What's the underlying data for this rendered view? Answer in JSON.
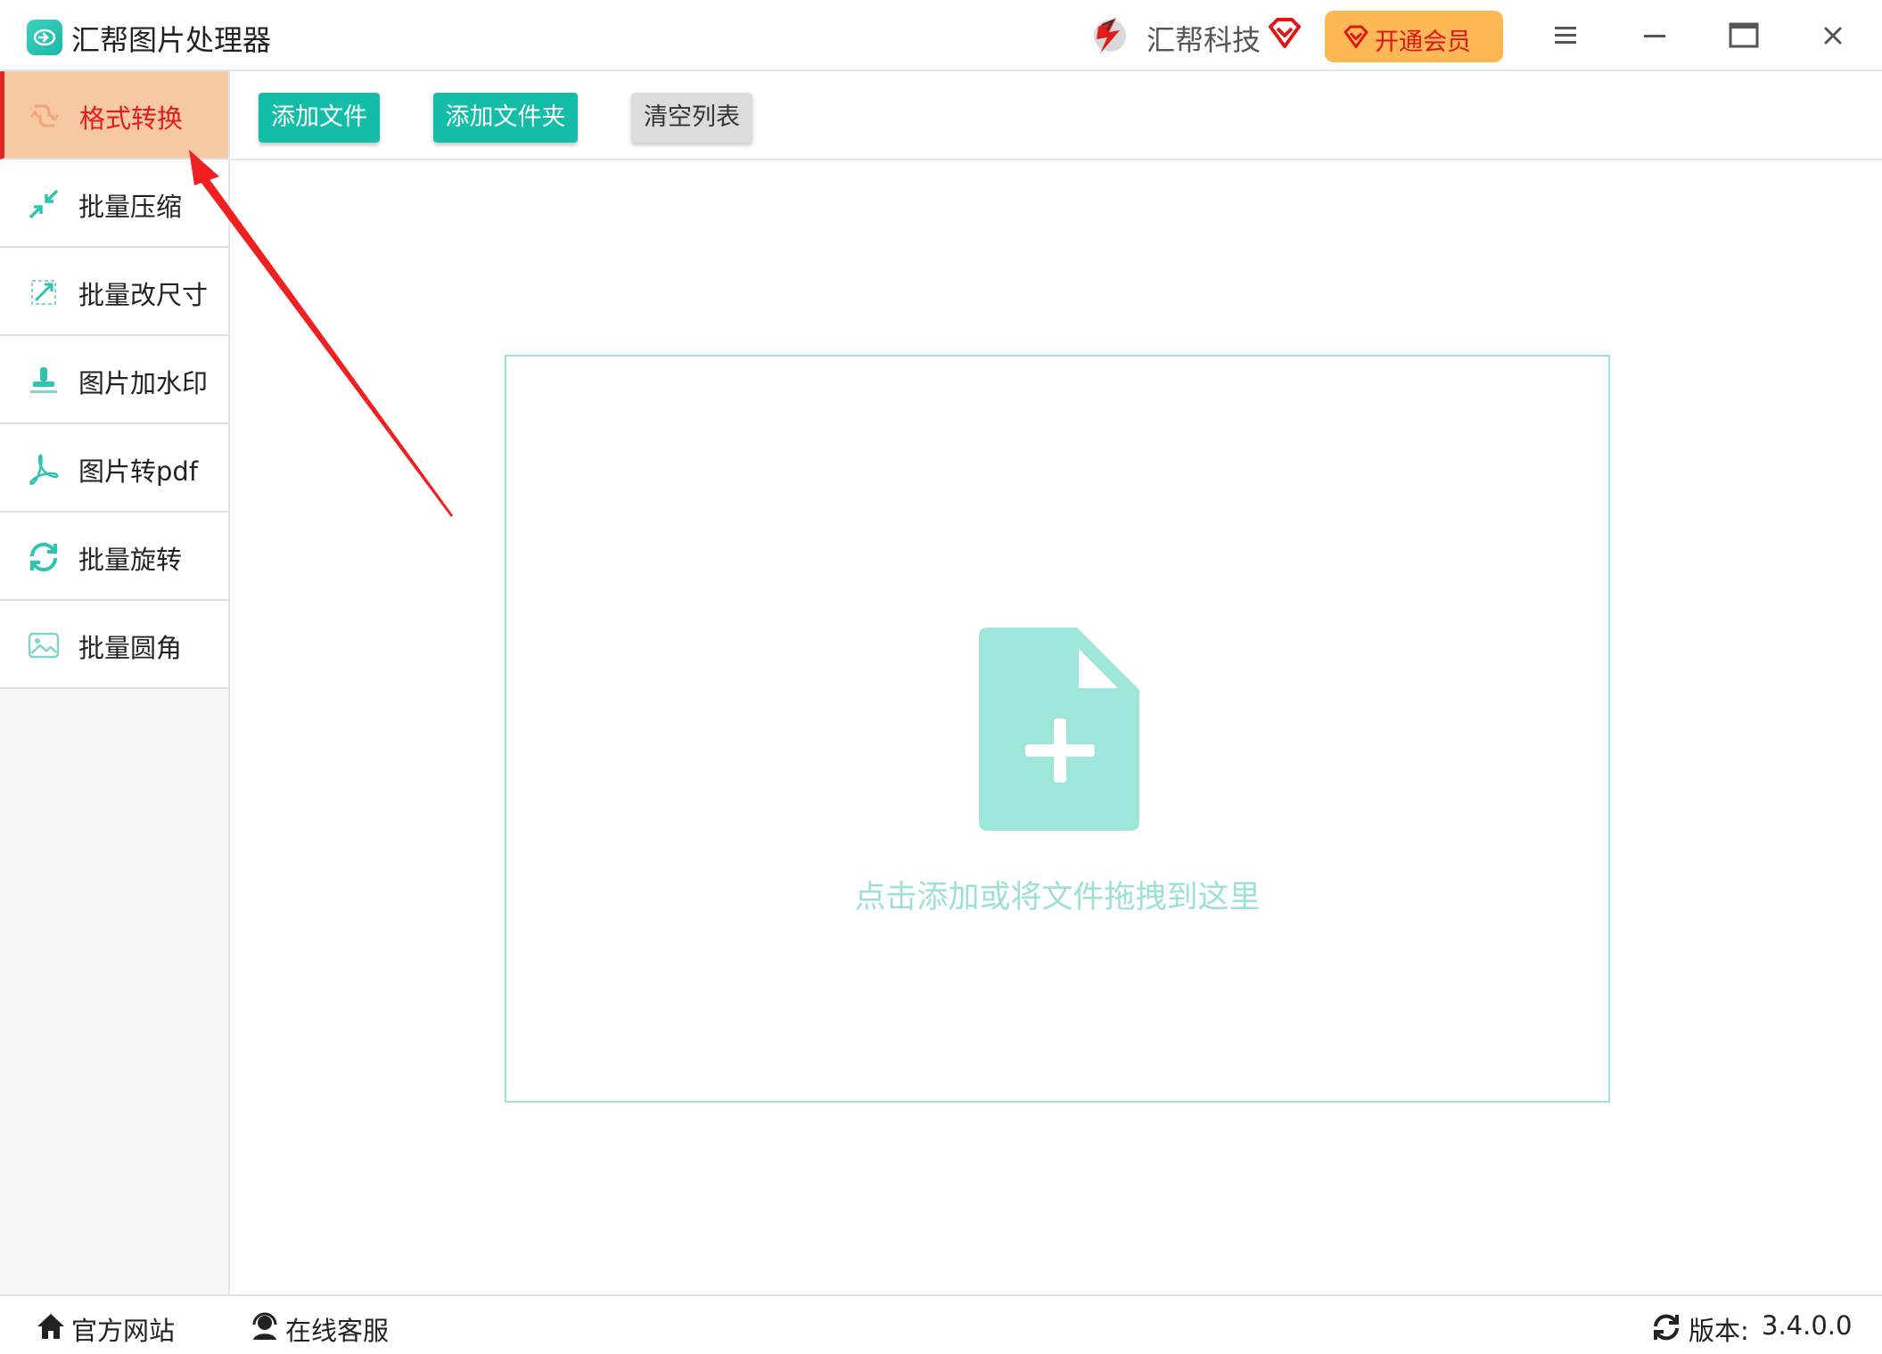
{
  "window": {
    "title": "汇帮图片处理器",
    "brand_name": "汇帮科技",
    "vip_label": "开通会员"
  },
  "sidebar": {
    "items": [
      {
        "label": "格式转换",
        "icon": "format-convert-icon",
        "active": true
      },
      {
        "label": "批量压缩",
        "icon": "compress-icon",
        "active": false
      },
      {
        "label": "批量改尺寸",
        "icon": "resize-icon",
        "active": false
      },
      {
        "label": "图片加水印",
        "icon": "watermark-icon",
        "active": false
      },
      {
        "label": "图片转pdf",
        "icon": "pdf-icon",
        "active": false
      },
      {
        "label": "批量旋转",
        "icon": "rotate-icon",
        "active": false
      },
      {
        "label": "批量圆角",
        "icon": "image-corner-icon",
        "active": false
      }
    ]
  },
  "toolbar": {
    "add_file": "添加文件",
    "add_folder": "添加文件夹",
    "clear_list": "清空列表"
  },
  "dropzone": {
    "hint": "点击添加或将文件拖拽到这里"
  },
  "statusbar": {
    "home": "官方网站",
    "service": "在线客服",
    "version_label": "版本:",
    "version": "3.4.0.0"
  },
  "colors": {
    "accent": "#14bda7",
    "active_bg": "#f7c9a3",
    "active_text": "#e61c1c",
    "vip_bg": "#fbb855",
    "dropzone_border": "#9fe3d8",
    "annotation_arrow": "#f02020"
  }
}
